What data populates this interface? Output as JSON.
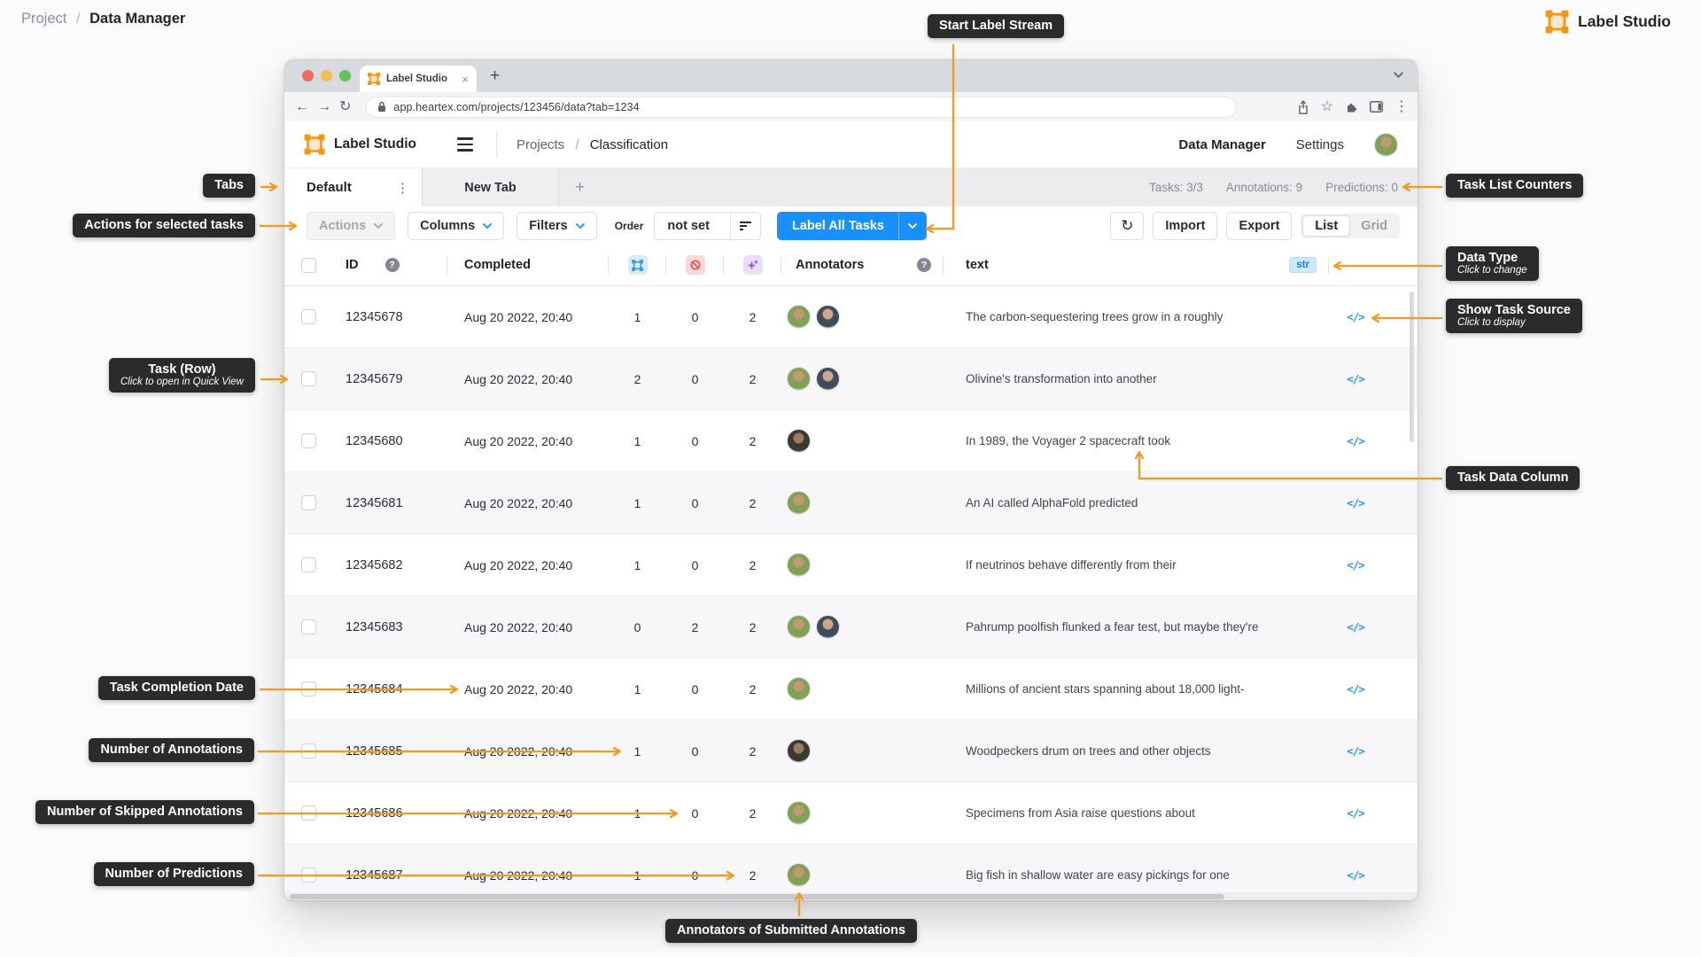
{
  "page": {
    "breadcrumb": {
      "project": "Project",
      "separator": "/",
      "current": "Data Manager"
    },
    "brand": "Label Studio"
  },
  "browser": {
    "tab_title": "Label Studio",
    "url": "app.heartex.com/projects/123456/data?tab=1234"
  },
  "icons": {
    "back": "←",
    "forward": "→",
    "reload": "↻",
    "star": "☆",
    "kebab": "⋮",
    "close": "×",
    "plus": "+",
    "code": "</>"
  },
  "app": {
    "brand": "Label Studio",
    "breadcrumb": {
      "projects": "Projects",
      "separator": "/",
      "current": "Classification"
    },
    "nav": {
      "data_manager": "Data Manager",
      "settings": "Settings"
    },
    "tabs": {
      "active": "Default",
      "new_tab": "New Tab",
      "add": "+"
    },
    "counters": {
      "tasks": "Tasks: 3/3",
      "annotations": "Annotations: 9",
      "predictions": "Predictions: 0"
    },
    "toolbar": {
      "actions": "Actions",
      "columns": "Columns",
      "filters": "Filters",
      "order_label": "Order",
      "order_value": "not set",
      "label_all_tasks": "Label All Tasks",
      "import": "Import",
      "export": "Export",
      "list": "List",
      "grid": "Grid"
    }
  },
  "table": {
    "headers": {
      "id": "ID",
      "completed": "Completed",
      "annotators": "Annotators",
      "text": "text",
      "data_type_badge": "str"
    },
    "rows": [
      {
        "id": "12345678",
        "completed": "Aug 20 2022, 20:40",
        "annotations": "1",
        "skipped": "0",
        "predictions": "2",
        "annotators": [
          "u1",
          "u2"
        ],
        "text": "The carbon-sequestering trees grow in a roughly"
      },
      {
        "id": "12345679",
        "completed": "Aug 20 2022, 20:40",
        "annotations": "2",
        "skipped": "0",
        "predictions": "2",
        "annotators": [
          "u1",
          "u2"
        ],
        "text": "Olivine's transformation into another"
      },
      {
        "id": "12345680",
        "completed": "Aug 20 2022, 20:40",
        "annotations": "1",
        "skipped": "0",
        "predictions": "2",
        "annotators": [
          "u3"
        ],
        "text": "In 1989, the Voyager 2 spacecraft took"
      },
      {
        "id": "12345681",
        "completed": "Aug 20 2022, 20:40",
        "annotations": "1",
        "skipped": "0",
        "predictions": "2",
        "annotators": [
          "u1"
        ],
        "text": "An AI called AlphaFold predicted"
      },
      {
        "id": "12345682",
        "completed": "Aug 20 2022, 20:40",
        "annotations": "1",
        "skipped": "0",
        "predictions": "2",
        "annotators": [
          "u1"
        ],
        "text": "If neutrinos behave differently from their"
      },
      {
        "id": "12345683",
        "completed": "Aug 20 2022, 20:40",
        "annotations": "0",
        "skipped": "2",
        "predictions": "2",
        "annotators": [
          "u1",
          "u2"
        ],
        "text": "Pahrump poolfish flunked a fear test, but maybe they're"
      },
      {
        "id": "12345684",
        "completed": "Aug 20 2022, 20:40",
        "annotations": "1",
        "skipped": "0",
        "predictions": "2",
        "annotators": [
          "u1"
        ],
        "text": "Millions of ancient stars spanning about 18,000 light-"
      },
      {
        "id": "12345685",
        "completed": "Aug 20 2022, 20:40",
        "annotations": "1",
        "skipped": "0",
        "predictions": "2",
        "annotators": [
          "u3"
        ],
        "text": "Woodpeckers drum on trees and other objects"
      },
      {
        "id": "12345686",
        "completed": "Aug 20 2022, 20:40",
        "annotations": "1",
        "skipped": "0",
        "predictions": "2",
        "annotators": [
          "u1"
        ],
        "text": "Specimens from Asia raise questions about"
      },
      {
        "id": "12345687",
        "completed": "Aug 20 2022, 20:40",
        "annotations": "1",
        "skipped": "0",
        "predictions": "2",
        "annotators": [
          "u1"
        ],
        "text": "Big fish in shallow water are easy pickings for one"
      }
    ]
  },
  "callouts": {
    "start_label_stream": {
      "label": "Start Label Stream"
    },
    "tabs": {
      "label": "Tabs"
    },
    "actions": {
      "label": "Actions for selected tasks"
    },
    "task_list_counters": {
      "label": "Task List Counters"
    },
    "data_type": {
      "label": "Data Type",
      "sub": "Click to change"
    },
    "show_task_source": {
      "label": "Show Task Source",
      "sub": "Click to display"
    },
    "task_row": {
      "label": "Task (Row)",
      "sub": "Click to open in Quick View"
    },
    "task_data_column": {
      "label": "Task Data Column"
    },
    "task_completion_date": {
      "label": "Task Completion Date"
    },
    "number_of_annotations": {
      "label": "Number of Annotations"
    },
    "number_of_skipped_annotations": {
      "label": "Number of Skipped Annotations"
    },
    "number_of_predictions": {
      "label": "Number of Predictions"
    },
    "annotators_of_submitted": {
      "label": "Annotators of Submitted Annotations"
    }
  },
  "colors": {
    "accent_orange": "#F39A1F",
    "primary_blue": "#1890FF",
    "callout_bg": "#2B2B2E",
    "brand_orange": "#F6980F"
  }
}
